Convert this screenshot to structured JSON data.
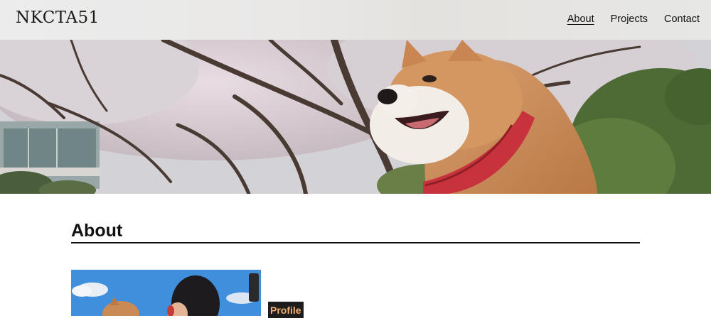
{
  "header": {
    "logo": "NKCTA51",
    "nav": [
      {
        "label": "About",
        "active": true
      },
      {
        "label": "Projects",
        "active": false
      },
      {
        "label": "Contact",
        "active": false
      }
    ]
  },
  "about": {
    "title": "About",
    "profile_tag": "Profile"
  },
  "colors": {
    "text": "#111111",
    "background": "#ffffff",
    "tag_background": "#1d1d1d",
    "tag_text": "#f0b070"
  }
}
